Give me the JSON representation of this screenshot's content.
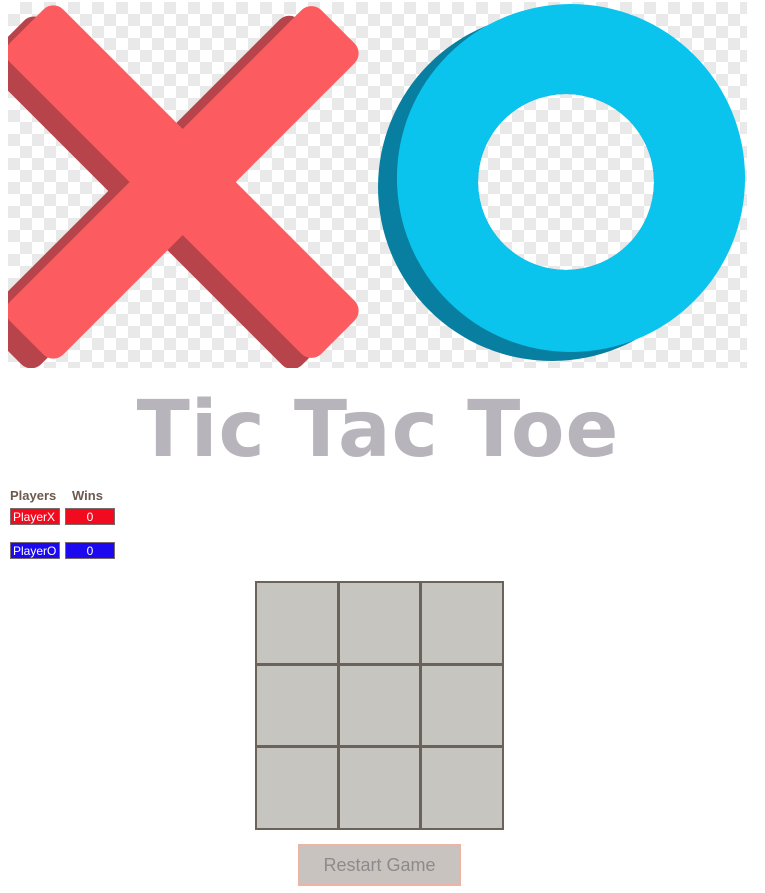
{
  "hero": {
    "logo_icon": "x-o-logo-icon"
  },
  "title": "Tic Tac Toe",
  "scoreboard": {
    "players_header": "Players",
    "wins_header": "Wins",
    "rows": [
      {
        "name": "PlayerX",
        "wins": "0",
        "color": "#f20a1e"
      },
      {
        "name": "PlayerO",
        "wins": "0",
        "color": "#1c09f0"
      }
    ]
  },
  "board": {
    "cells": [
      "",
      "",
      "",
      "",
      "",
      "",
      "",
      "",
      ""
    ]
  },
  "restart_label": "Restart Game",
  "colors": {
    "x_mark": "#fc5c5f",
    "o_mark": "#0ac4ee",
    "title": "#b8b4bb",
    "board_line": "#6b6259",
    "cell": "#c7c5c0"
  }
}
